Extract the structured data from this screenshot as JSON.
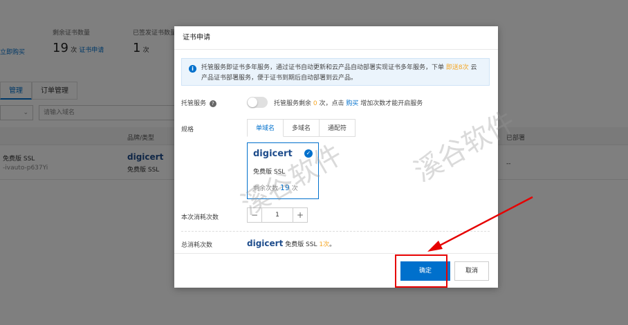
{
  "background": {
    "stats": [
      {
        "label": "",
        "link": "立即购买"
      },
      {
        "label": "剩余证书数量",
        "value": "19",
        "unit": "次",
        "link": "证书申请"
      },
      {
        "label": "已签发证书数量",
        "value": "1",
        "unit": "次"
      }
    ],
    "tabs": [
      "管理",
      "订单管理"
    ],
    "filter_select": "",
    "search_placeholder": "请输入域名",
    "table_headers": [
      "品牌/类型",
      "已部署"
    ],
    "row": {
      "name": "免费版 SSL",
      "id": "-ivauto-p637Yi",
      "brand": "digicert",
      "brand_type": "免费版 SSL",
      "deployed": "--"
    }
  },
  "watermark": "溪谷软件",
  "modal": {
    "title": "证书申请",
    "notice_text_1": "托管服务即证书多年服务，通过证书自动更新和云产品自动部署实现证书多年服务，下单 ",
    "notice_highlight": "即送8次",
    "notice_text_2": " 云产品证书部署服务，便于证书到期后自动部署到云产品。",
    "hosting_label": "托管服务",
    "hosting_text_1": "托管服务剩余 ",
    "hosting_count": "0",
    "hosting_text_2": " 次，点击 ",
    "hosting_link": "购买",
    "hosting_text_3": " 增加次数才能开启服务",
    "spec_label": "规格",
    "spec_tabs": [
      "单域名",
      "多域名",
      "通配符"
    ],
    "card": {
      "brand": "digicert",
      "product": "免费版 SSL",
      "remain_label": "剩余次数",
      "remain_value": "19",
      "remain_unit": "次"
    },
    "consume_label": "本次消耗次数",
    "stepper": {
      "minus": "−",
      "value": "1",
      "plus": "+"
    },
    "total_label": "总消耗次数",
    "total": {
      "brand": "digicert",
      "product": "免费版 SSL ",
      "count": "1次",
      "suffix": "。"
    },
    "confirm_label": "确定",
    "cancel_label": "取消"
  },
  "colors": {
    "primary": "#0070cc",
    "accent": "#f5a623",
    "annotation": "#e60000"
  }
}
